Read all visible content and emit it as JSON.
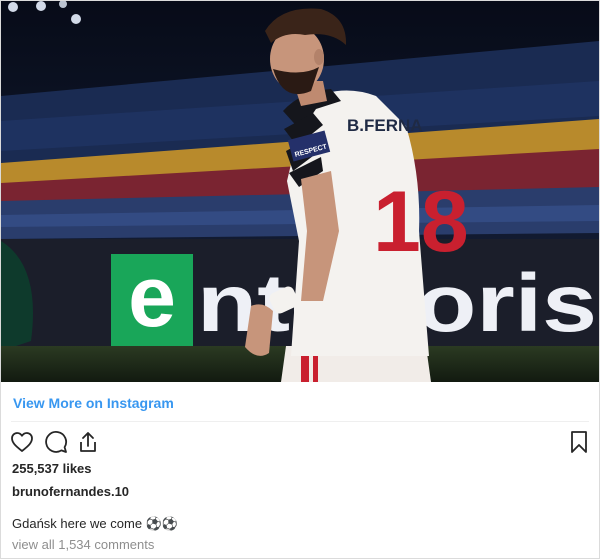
{
  "post": {
    "photo_alt": "",
    "banner": {
      "logo_text": "e",
      "word_text": "ntertoris"
    },
    "shirt": {
      "name": "B.FERNA",
      "number": "18",
      "patch": "RESPECT"
    }
  },
  "links": {
    "view_more": "View More on Instagram"
  },
  "actions": {
    "like_icon": "heart-icon",
    "comment_icon": "comment-icon",
    "share_icon": "share-icon",
    "save_icon": "bookmark-icon"
  },
  "stats": {
    "likes": "255,537 likes"
  },
  "author": {
    "username": "brunofernandes.10"
  },
  "caption": {
    "text": "Gdańsk here we come ⚽⚽"
  },
  "comments": {
    "view_all": "view all 1,534 comments"
  },
  "colors": {
    "link_blue": "#3897f0",
    "text_dark": "#262626",
    "text_muted": "#8e8e8e",
    "banner_green": "#19a659"
  }
}
